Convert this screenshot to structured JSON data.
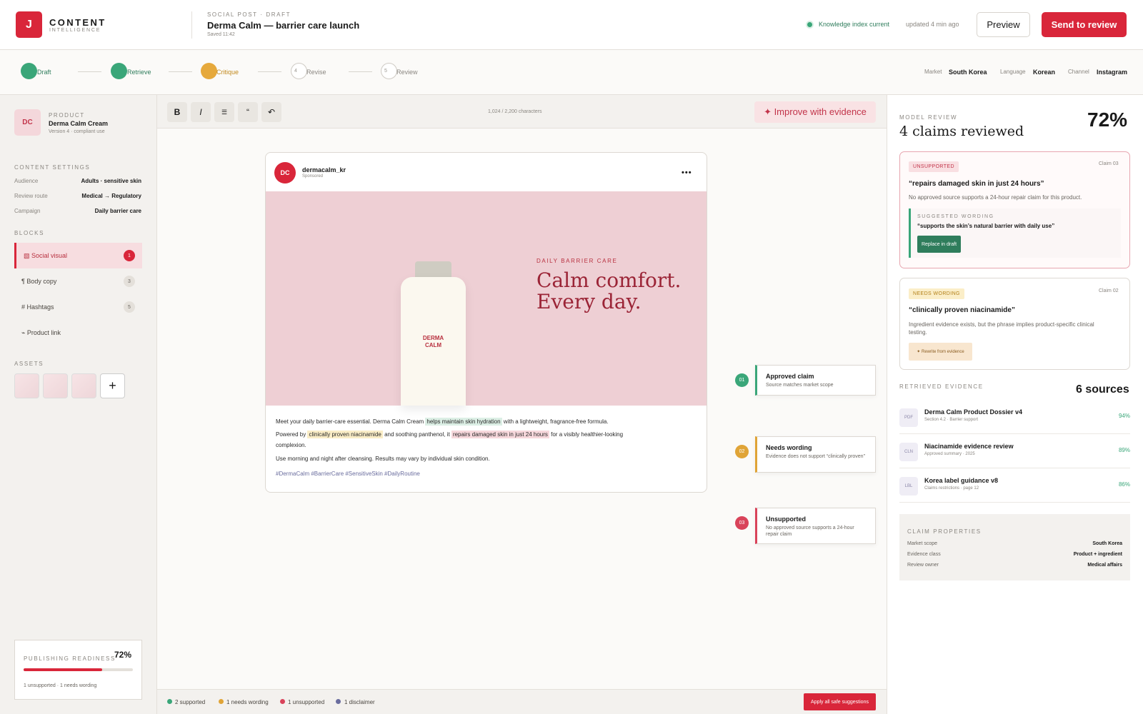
{
  "header": {
    "logo_letter": "J",
    "brand": "CONTENT",
    "brand_sub": "INTELLIGENCE",
    "doc_type": "SOCIAL POST · DRAFT",
    "doc_title": "Derma Calm — barrier care launch",
    "saved": "Saved 11:42",
    "knowledge_status": "Knowledge index current",
    "updated": "updated 4 min ago",
    "preview_label": "Preview",
    "send_label": "Send to review"
  },
  "steps": [
    {
      "num": "",
      "label": "Draft",
      "state": "done"
    },
    {
      "num": "",
      "label": "Retrieve",
      "state": "done"
    },
    {
      "num": "",
      "label": "Critique",
      "state": "active"
    },
    {
      "num": "4",
      "label": "Revise",
      "state": "todo"
    },
    {
      "num": "5",
      "label": "Review",
      "state": "todo"
    }
  ],
  "meta": {
    "market_label": "Market",
    "market": "South Korea",
    "language_label": "Language",
    "language": "Korean",
    "channel_label": "Channel",
    "channel": "Instagram"
  },
  "sidebar": {
    "product_initials": "DC",
    "product_cap": "PRODUCT",
    "product_name": "Derma Calm Cream",
    "product_version": "Version 4 · compliant use",
    "settings_cap": "CONTENT SETTINGS",
    "settings": [
      {
        "k": "Audience",
        "v": "Adults · sensitive skin"
      },
      {
        "k": "Review route",
        "v": "Medical → Regulatory"
      },
      {
        "k": "Campaign",
        "v": "Daily barrier care"
      }
    ],
    "blocks_cap": "BLOCKS",
    "blocks": [
      {
        "label": "▧ Social visual",
        "count": "1"
      },
      {
        "label": "¶ Body copy",
        "count": "3"
      },
      {
        "label": "# Hashtags",
        "count": "5"
      },
      {
        "label": "⌁ Product link",
        "count": ""
      }
    ],
    "assets_cap": "ASSETS",
    "asset_add": "+",
    "readiness_cap": "PUBLISHING READINESS",
    "readiness_pct": "72%",
    "readiness_value": 0.72,
    "readiness_note": "1 unsupported · 1 needs wording"
  },
  "toolbar": {
    "bold": "B",
    "italic": "I",
    "list": "☰",
    "quote": "“",
    "undo": "↶",
    "chars": "1,024 / 2,200 characters",
    "improve": "✦ Improve with evidence"
  },
  "post": {
    "avatar": "DC",
    "account": "dermacalm_kr",
    "sponsored": "Sponsored",
    "more": "•••",
    "bottle_text_1": "DERMA",
    "bottle_text_2": "CALM",
    "kicker": "DAILY BARRIER CARE",
    "headline_1": "Calm comfort.",
    "headline_2": "Every day.",
    "p1_a": "Meet your daily barrier-care essential. Derma Calm Cream ",
    "p1_hl": "helps maintain skin hydration",
    "p1_b": " with a lightweight, fragrance-free formula.",
    "p2_a": "Powered by ",
    "p2_hl1": "clinically proven niacinamide",
    "p2_b": " and soothing panthenol, it ",
    "p2_hl2": "repairs damaged skin in just 24 hours",
    "p2_c": " for a visibly healthier-looking",
    "p2_d": "complexion.",
    "p3": "Use morning and night after cleansing. Results may vary by individual skin condition.",
    "tags": "#DermaCalm #BarrierCare #SensitiveSkin #DailyRoutine"
  },
  "notes": [
    {
      "num": "01",
      "title": "Approved claim",
      "desc": "Source matches market scope",
      "color": "#3aa679"
    },
    {
      "num": "02",
      "title": "Needs wording",
      "desc": "Evidence does not support “clinically proven”",
      "color": "#e0a437"
    },
    {
      "num": "03",
      "title": "Unsupported",
      "desc": "No approved source supports a 24-hour repair claim",
      "color": "#d9435a"
    }
  ],
  "status": {
    "supported": "2 supported",
    "wording": "1 needs wording",
    "unsupported": "1 unsupported",
    "disclaimer": "1 disclaimer",
    "apply": "Apply all safe suggestions"
  },
  "review": {
    "cap": "MODEL REVIEW",
    "title": "4 claims reviewed",
    "pct": "72%",
    "claims": [
      {
        "badge": "UNSUPPORTED",
        "id": "Claim 03",
        "quote": "“repairs damaged skin in just 24 hours”",
        "desc": "No approved source supports a 24-hour repair claim for this product.",
        "suggest_cap": "SUGGESTED WORDING",
        "suggest": "“supports the skin’s natural barrier with daily use”",
        "action": "Replace in draft"
      },
      {
        "badge": "NEEDS WORDING",
        "id": "Claim 02",
        "quote": "“clinically proven niacinamide”",
        "desc_1": "Ingredient evidence exists, but the phrase implies product-specific clinical",
        "desc_2": "testing.",
        "action": "✦ Rewrite from evidence"
      }
    ],
    "evidence_cap": "RETRIEVED EVIDENCE",
    "evidence_count": "6 sources",
    "sources": [
      {
        "icon": "PDF",
        "name": "Derma Calm Product Dossier v4",
        "sub": "Section 4.2 · Barrier support",
        "pct": "94%"
      },
      {
        "icon": "CLN",
        "name": "Niacinamide evidence review",
        "sub": "Approved summary · 2025",
        "pct": "89%"
      },
      {
        "icon": "LBL",
        "name": "Korea label guidance v8",
        "sub": "Claims restrictions · page 12",
        "pct": "86%"
      }
    ],
    "props_cap": "CLAIM PROPERTIES",
    "props": [
      {
        "k": "Market scope",
        "v": "South Korea"
      },
      {
        "k": "Evidence class",
        "v": "Product + ingredient"
      },
      {
        "k": "Review owner",
        "v": "Medical affairs"
      }
    ]
  },
  "colors": {
    "brand": "#d9263a",
    "supported": "#3aa679",
    "wording": "#e0a437",
    "unsupported": "#d9435a",
    "disclaimer": "#6a6d9e"
  }
}
